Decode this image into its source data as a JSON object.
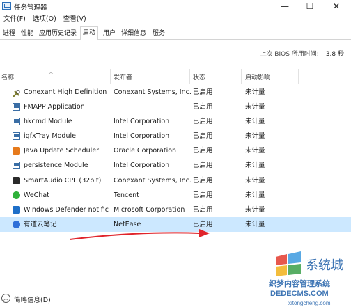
{
  "window": {
    "title": "任务管理器",
    "controls": {
      "minimize": "—",
      "maximize": "☐",
      "close": "✕"
    }
  },
  "menu": [
    "文件(F)",
    "选项(O)",
    "查看(V)"
  ],
  "tabs": [
    "进程",
    "性能",
    "应用历史记录",
    "启动",
    "用户",
    "详细信息",
    "服务"
  ],
  "active_tab": "启动",
  "bios": {
    "label": "上次 BIOS 所用时间:",
    "value": "3.8 秒"
  },
  "columns": {
    "name": "名称",
    "publisher": "发布者",
    "status": "状态",
    "impact": "启动影响"
  },
  "rows": [
    {
      "icon": "conexant-tools-icon",
      "name": "Conexant High Definition ...",
      "publisher": "Conexant Systems, Inc.",
      "status": "已启用",
      "impact": "未计量"
    },
    {
      "icon": "app-window-icon",
      "name": "FMAPP Application",
      "publisher": "",
      "status": "已启用",
      "impact": "未计量"
    },
    {
      "icon": "app-window-icon",
      "name": "hkcmd Module",
      "publisher": "Intel Corporation",
      "status": "已启用",
      "impact": "未计量"
    },
    {
      "icon": "app-window-icon",
      "name": "igfxTray Module",
      "publisher": "Intel Corporation",
      "status": "已启用",
      "impact": "未计量"
    },
    {
      "icon": "java-icon",
      "name": "Java Update Scheduler",
      "publisher": "Oracle Corporation",
      "status": "已启用",
      "impact": "未计量"
    },
    {
      "icon": "app-window-icon",
      "name": "persistence Module",
      "publisher": "Intel Corporation",
      "status": "已启用",
      "impact": "未计量"
    },
    {
      "icon": "smartaudio-icon",
      "name": "SmartAudio CPL (32bit)",
      "publisher": "Conexant Systems, Inc.",
      "status": "已启用",
      "impact": "未计量"
    },
    {
      "icon": "wechat-icon",
      "name": "WeChat",
      "publisher": "Tencent",
      "status": "已启用",
      "impact": "未计量"
    },
    {
      "icon": "defender-icon",
      "name": "Windows Defender notific...",
      "publisher": "Microsoft Corporation",
      "status": "已启用",
      "impact": "未计量"
    },
    {
      "icon": "youdao-note-icon",
      "name": "有道云笔记",
      "publisher": "NetEase",
      "status": "已启用",
      "impact": "未计量"
    }
  ],
  "footer": {
    "label": "简略信息(D)"
  },
  "watermark": {
    "brand": "系统城",
    "line1": "织梦内容管理系统",
    "line2": "DEDECMS.COM",
    "url": "xitongcheng.com"
  },
  "colors": {
    "selected_row": "#cce8ff",
    "arrow": "#e0242b",
    "accent": "#2c6fb8"
  }
}
